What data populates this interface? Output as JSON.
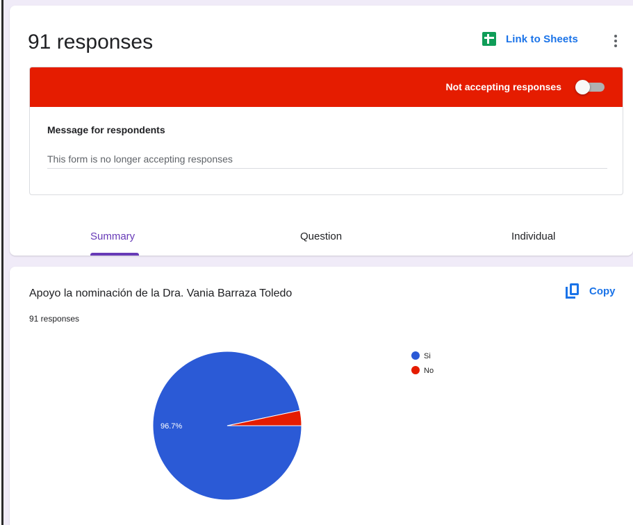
{
  "header": {
    "title": "91 responses",
    "link_to_sheets": "Link to Sheets"
  },
  "status": {
    "banner_text": "Not accepting responses",
    "accepting": false,
    "message_label": "Message for respondents",
    "message_value": "This form is no longer accepting responses"
  },
  "tabs": [
    {
      "label": "Summary",
      "active": true
    },
    {
      "label": "Question",
      "active": false
    },
    {
      "label": "Individual",
      "active": false
    }
  ],
  "question": {
    "title": "Apoyo la nominación de la Dra. Vania Barraza Toledo",
    "response_count": "91 responses",
    "copy_label": "Copy"
  },
  "colors": {
    "banner": "#e51c00",
    "accent": "#673ab7",
    "link": "#1a73e8",
    "sheets": "#0f9d58"
  },
  "chart_data": {
    "type": "pie",
    "categories": [
      "Si",
      "No"
    ],
    "values": [
      96.7,
      3.3
    ],
    "colors": [
      "#2b5ad6",
      "#e51c00"
    ],
    "data_labels": [
      "96.7%",
      ""
    ],
    "legend_position": "right"
  }
}
